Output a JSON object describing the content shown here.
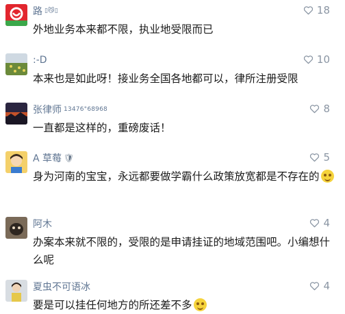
{
  "comments": [
    {
      "name": "路",
      "name_suffix": "▯😼▯",
      "likes": "18",
      "text": "外地业务本来都不限，执业地受限而已",
      "avatar_icon": "red-heart-logo-avatar"
    },
    {
      "name": ":-D",
      "likes": "10",
      "text": "本来也是如此呀！接业务全国各地都可以，律所注册受限",
      "avatar_icon": "landscape-photo-avatar"
    },
    {
      "name": "张律师",
      "name_suffix": "13476°68968",
      "likes": "8",
      "text": "一直都是这样的，重磅废话！",
      "avatar_icon": "sunset-mountain-avatar"
    },
    {
      "name": "A 草莓",
      "name_badge": "🛡",
      "likes": "5",
      "text": "身为河南的宝宝，永远都要做学霸什么政策放宽都是不存在的",
      "has_emoji": true,
      "avatar_icon": "cartoon-child-avatar"
    },
    {
      "name": "阿木",
      "likes": "4",
      "text": "办案本来就不限的，受限的是申请挂证的地域范围吧。小编想什么呢",
      "avatar_icon": "animal-photo-avatar"
    },
    {
      "name": "夏虫不可语冰",
      "likes": "4",
      "text": "要是可以挂任何地方的所还差不多",
      "has_emoji": true,
      "avatar_icon": "person-photo-avatar"
    }
  ],
  "colors": {
    "name": "#5f7592",
    "text": "#1a1a1a",
    "like": "#8a95a3"
  }
}
